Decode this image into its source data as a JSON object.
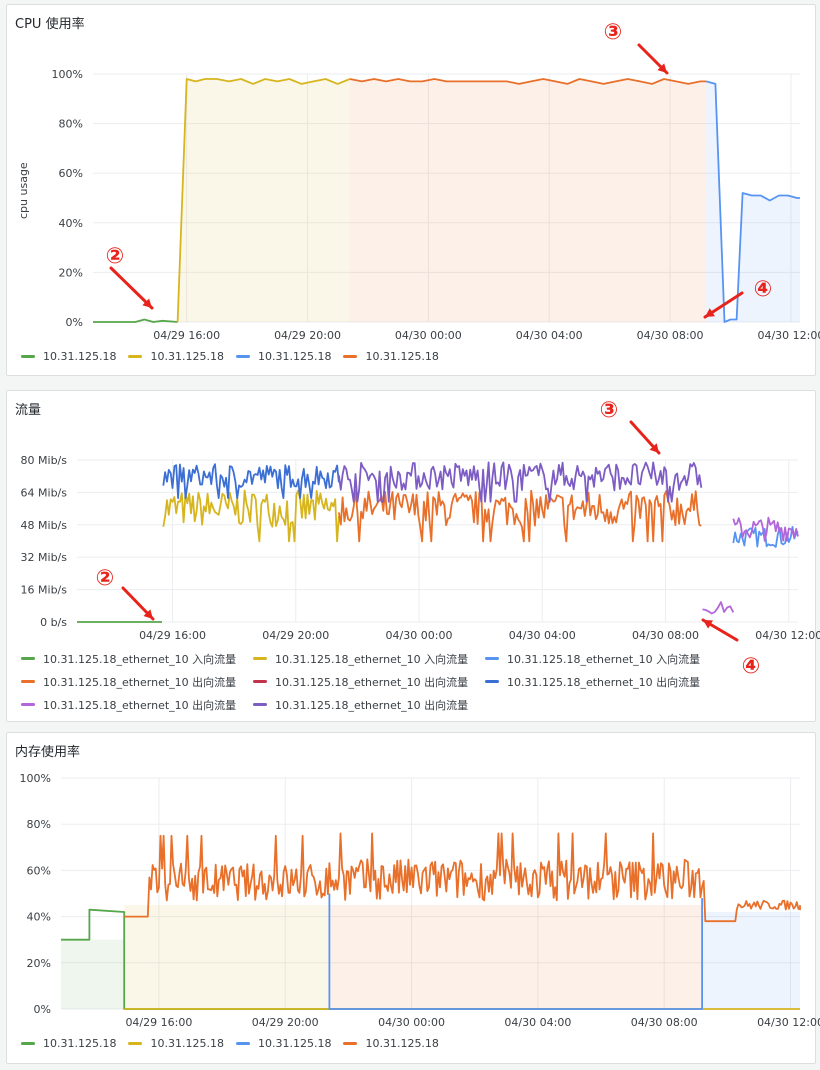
{
  "colors": {
    "green": "#56a64b",
    "yellow": "#d6b51f",
    "blue": "#5794f2",
    "orange": "#e8702a",
    "red": "#c4314b",
    "darkblue": "#3b6fd4",
    "purple": "#b266d9",
    "violet": "#7d5cc4",
    "annotation": "#e8231b",
    "grid": "#ebedf0",
    "axis_text": "#3a3f44"
  },
  "cpu_panel": {
    "title": "CPU 使用率",
    "chart_data": {
      "type": "line",
      "ylabel": "cpu usage",
      "yticks": [
        "100%",
        "80%",
        "60%",
        "40%",
        "20%",
        "0%"
      ],
      "ylim": [
        0,
        100
      ],
      "xticks": [
        "04/29 16:00",
        "04/29 20:00",
        "04/30 00:00",
        "04/30 04:00",
        "04/30 08:00",
        "04/30 12:00"
      ],
      "xlim_hours": [
        12.9,
        36.3
      ],
      "series": [
        {
          "name": "10.31.125.18",
          "color": "green",
          "x": [
            12.9,
            14.3,
            14.6,
            14.9,
            15.2,
            15.7
          ],
          "y": [
            0,
            0,
            1,
            0,
            0.5,
            0
          ],
          "fill": false
        },
        {
          "name": "10.31.125.18",
          "color": "yellow",
          "x": [
            15.7,
            16.0,
            16.3,
            16.6,
            17.0,
            17.4,
            17.8,
            18.2,
            18.6,
            19.0,
            19.4,
            19.8,
            20.2,
            20.6,
            21.0,
            21.4
          ],
          "y": [
            0,
            98,
            97,
            98,
            98,
            97,
            98,
            96,
            98,
            97,
            98,
            96,
            97,
            98,
            96,
            98
          ],
          "fill": true
        },
        {
          "name": "10.31.125.18",
          "color": "blue",
          "x": [
            33.2,
            33.5,
            33.8,
            34.0,
            34.2,
            34.4,
            34.7,
            35.0,
            35.3,
            35.6,
            35.9,
            36.2,
            36.3
          ],
          "y": [
            97,
            96,
            0,
            1,
            1,
            52,
            51,
            51,
            49,
            51,
            51,
            50,
            50
          ],
          "fill": true
        },
        {
          "name": "10.31.125.18",
          "color": "orange",
          "x": [
            21.4,
            21.8,
            22.2,
            22.6,
            23.0,
            23.4,
            23.8,
            24.2,
            24.6,
            25.0,
            25.4,
            25.8,
            26.2,
            26.6,
            27.0,
            27.4,
            27.8,
            28.2,
            28.6,
            29.0,
            29.4,
            29.8,
            30.2,
            30.6,
            31.0,
            31.4,
            31.8,
            32.2,
            32.6,
            33.0,
            33.2
          ],
          "y": [
            98,
            97,
            98,
            97,
            98,
            97,
            97,
            98,
            97,
            97,
            97,
            97,
            97,
            97,
            96,
            97,
            98,
            97,
            96,
            98,
            97,
            96,
            97,
            98,
            97,
            96,
            98,
            97,
            96,
            97,
            97
          ],
          "fill": true
        }
      ]
    },
    "annotations": [
      "②",
      "③",
      "④"
    ]
  },
  "net_panel": {
    "title": "流量",
    "chart_data": {
      "type": "line",
      "yticks": [
        "80 Mib/s",
        "64 Mib/s",
        "48 Mib/s",
        "32 Mib/s",
        "16 Mib/s",
        "0 b/s"
      ],
      "ylim": [
        0,
        80
      ],
      "xticks": [
        "04/29 16:00",
        "04/29 20:00",
        "04/30 00:00",
        "04/30 04:00",
        "04/30 08:00",
        "04/30 12:00"
      ],
      "xlim_hours": [
        12.9,
        36.3
      ],
      "series": [
        {
          "name": "10.31.125.18_ethernet_10 入向流量",
          "color": "green",
          "segments": [
            [
              12.9,
              15.7,
              0,
              0
            ]
          ]
        },
        {
          "name": "10.31.125.18_ethernet_10 入向流量",
          "color": "yellow",
          "segments": [
            [
              15.7,
              21.4,
              56,
              9
            ]
          ]
        },
        {
          "name": "10.31.125.18_ethernet_10 入向流量",
          "color": "blue",
          "segments": [
            [
              34.2,
              36.3,
              42,
              5
            ]
          ]
        },
        {
          "name": "10.31.125.18_ethernet_10 出向流量",
          "color": "orange",
          "segments": [
            [
              21.4,
              33.2,
              56,
              9
            ]
          ]
        },
        {
          "name": "10.31.125.18_ethernet_10 出向流量",
          "color": "red",
          "segments": []
        },
        {
          "name": "10.31.125.18_ethernet_10 出向流量",
          "color": "darkblue",
          "segments": [
            [
              15.7,
              21.4,
              72,
              6
            ]
          ]
        },
        {
          "name": "10.31.125.18_ethernet_10 出向流量",
          "color": "purple",
          "segments": [
            [
              33.2,
              34.2,
              7,
              3
            ],
            [
              34.2,
              36.3,
              46,
              6
            ]
          ]
        },
        {
          "name": "10.31.125.18_ethernet_10 出向流量",
          "color": "violet",
          "segments": [
            [
              21.4,
              33.2,
              72,
              7
            ]
          ]
        }
      ]
    },
    "annotations": [
      "②",
      "③",
      "④"
    ]
  },
  "mem_panel": {
    "title": "内存使用率",
    "chart_data": {
      "type": "line",
      "yticks": [
        "100%",
        "80%",
        "60%",
        "40%",
        "20%",
        "0%"
      ],
      "ylim": [
        0,
        100
      ],
      "xticks": [
        "04/29 16:00",
        "04/29 20:00",
        "04/30 00:00",
        "04/30 04:00",
        "04/30 08:00",
        "04/30 12:00"
      ],
      "xlim_hours": [
        12.9,
        36.3
      ],
      "series": [
        {
          "name": "10.31.125.18",
          "color": "green",
          "x": [
            12.9,
            13.8,
            13.8,
            14.9,
            14.9,
            30.0
          ],
          "y": [
            30,
            30,
            43,
            42,
            0,
            0
          ],
          "fill_until": 14.9
        },
        {
          "name": "10.31.125.18",
          "color": "yellow",
          "x": [
            14.9,
            21.4,
            33.3,
            36.3
          ],
          "y": [
            0,
            0,
            0,
            0
          ],
          "fill_from": 14.9,
          "fill_until": 21.4
        },
        {
          "name": "10.31.125.18",
          "color": "blue",
          "x": [
            21.4,
            21.4,
            33.2,
            33.2
          ],
          "y": [
            50,
            0,
            0,
            48
          ],
          "fill_from": 33.2
        },
        {
          "name": "10.31.125.18",
          "color": "orange",
          "base": [
            [
              14.9,
              40,
              0
            ],
            [
              15.7,
              55,
              8
            ],
            [
              21.4,
              56,
              9
            ],
            [
              33.2,
              57,
              9
            ],
            [
              33.3,
              38,
              0
            ],
            [
              34.2,
              38,
              0
            ],
            [
              34.3,
              45,
              2
            ],
            [
              36.3,
              45,
              2
            ]
          ],
          "fill_from": 21.4,
          "fill_until": 33.2
        }
      ]
    }
  }
}
